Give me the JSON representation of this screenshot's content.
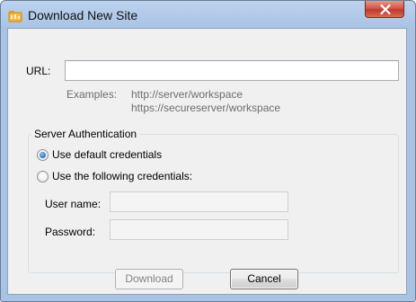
{
  "window": {
    "title": "Download New Site",
    "close_label": "x"
  },
  "url": {
    "label": "URL:",
    "value": "",
    "placeholder": ""
  },
  "examples": {
    "label": "Examples:",
    "line1": "http://server/workspace",
    "line2": "https://secureserver/workspace"
  },
  "auth": {
    "group_title": "Server Authentication",
    "option_default": "Use default credentials",
    "option_custom": "Use the following credentials:",
    "selected": "default",
    "username_label": "User name:",
    "username_value": "",
    "password_label": "Password:",
    "password_value": ""
  },
  "buttons": {
    "download": "Download",
    "cancel": "Cancel"
  },
  "colors": {
    "frame": "#a9c3e5",
    "close": "#c0392b",
    "client": "#f0f0f0",
    "radio_selected": "#2a6fc0"
  },
  "icons": {
    "app": "folder-icon",
    "close": "close-icon"
  }
}
